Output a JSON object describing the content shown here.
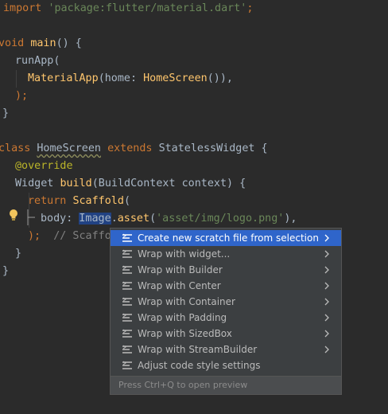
{
  "code": {
    "l1": {
      "kw": "import",
      "str": "'package:flutter/material.dart'",
      "semi": ";"
    },
    "l2": {
      "kw": "void",
      "fn": "main",
      "rest": "() {"
    },
    "l3": {
      "text": "runApp("
    },
    "l4": {
      "cls": "MaterialApp",
      "mid": "(home: ",
      "cls2": "HomeScreen",
      "end": "()),"
    },
    "l5": {
      "text": ");"
    },
    "l6": {
      "text": "}"
    },
    "l7": {
      "kw": "class",
      "cls": "HomeScreen",
      "kw2": "extends",
      "rest": "StatelessWidget {"
    },
    "l8": {
      "ann": "@override"
    },
    "l9": {
      "a": "Widget ",
      "fn": "build",
      "rest": "(BuildContext context) {"
    },
    "l10": {
      "kw": "return",
      "cls": "Scaffold",
      "rest": "("
    },
    "l11": {
      "a": "body: ",
      "sel": "Image",
      "b": ".",
      "fn": "asset",
      "c": "(",
      "str": "'asset/img/logo.png'",
      "d": "),"
    },
    "l12": {
      "a": ");",
      "cmt": "// Scaffo"
    },
    "l13": {
      "text": "}"
    },
    "l14": {
      "text": "}"
    }
  },
  "menu": {
    "items": [
      {
        "label": "Create new scratch file from selection",
        "submenu": true,
        "selected": true
      },
      {
        "label": "Wrap with widget...",
        "submenu": true
      },
      {
        "label": "Wrap with Builder",
        "submenu": true
      },
      {
        "label": "Wrap with Center",
        "submenu": true
      },
      {
        "label": "Wrap with Container",
        "submenu": true
      },
      {
        "label": "Wrap with Padding",
        "submenu": true
      },
      {
        "label": "Wrap with SizedBox",
        "submenu": true
      },
      {
        "label": "Wrap with StreamBuilder",
        "submenu": true
      },
      {
        "label": "Adjust code style settings",
        "submenu": false
      }
    ],
    "footer": "Press Ctrl+Q to open preview"
  },
  "colors": {
    "background": "#2b2b2b",
    "keyword": "#cc7832",
    "string": "#6a8759",
    "function": "#ffc66d",
    "menu_selected": "#2f65ca"
  },
  "icons": {
    "intention": "lightbulb-icon",
    "menu_item": "intention-action-icon",
    "submenu": "chevron-right-icon"
  }
}
